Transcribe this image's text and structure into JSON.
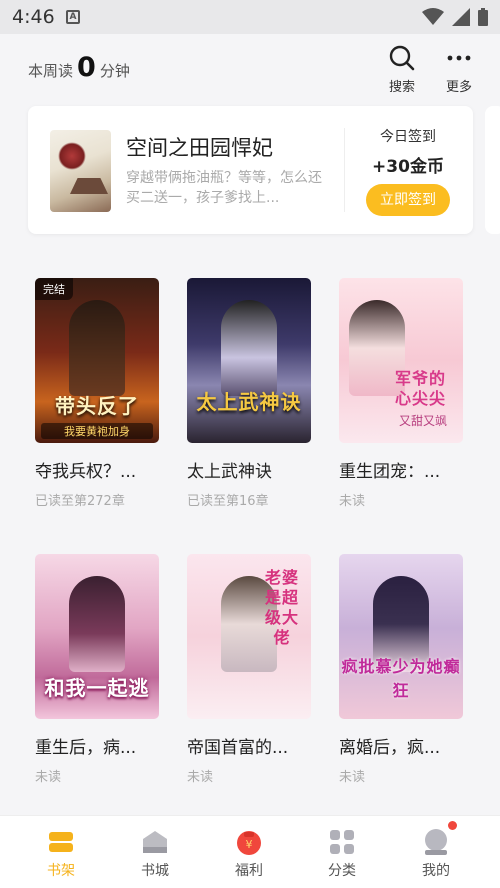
{
  "status_bar": {
    "time": "4:46",
    "notification_letter": "A"
  },
  "header": {
    "weekly_prefix": "本周读",
    "weekly_minutes": "0",
    "weekly_suffix": "分钟",
    "search_label": "搜索",
    "more_label": "更多"
  },
  "featured": {
    "title": "空间之田园悍妃",
    "description": "穿越带俩拖油瓶？等等，怎么还买二送一，孩子爹找上...",
    "checkin_label": "今日签到",
    "checkin_reward": "+30金币",
    "checkin_button": "立即签到"
  },
  "books": [
    {
      "title": "夺我兵权？...",
      "progress": "已读至第272章",
      "tag": "完结",
      "cover_text": "带头反了",
      "cover_subtitle": "我要黄袍加身"
    },
    {
      "title": "太上武神诀",
      "progress": "已读至第16章",
      "tag": "",
      "cover_text": "太上武神诀",
      "cover_subtitle": ""
    },
    {
      "title": "重生团宠：...",
      "progress": "未读",
      "tag": "",
      "cover_text": "军爷的心尖尖",
      "cover_subtitle": "又甜又飒"
    },
    {
      "title": "重生后，病...",
      "progress": "未读",
      "tag": "",
      "cover_text": "和我一起逃",
      "cover_subtitle": ""
    },
    {
      "title": "帝国首富的...",
      "progress": "未读",
      "tag": "",
      "cover_text": "老婆是超级大佬",
      "cover_subtitle": ""
    },
    {
      "title": "离婚后，疯...",
      "progress": "未读",
      "tag": "",
      "cover_text": "疯批慕少为她癫狂",
      "cover_subtitle": ""
    }
  ],
  "nav": {
    "items": [
      {
        "label": "书架",
        "icon": "bookshelf-icon"
      },
      {
        "label": "书城",
        "icon": "bookstore-icon"
      },
      {
        "label": "福利",
        "icon": "red-envelope-icon"
      },
      {
        "label": "分类",
        "icon": "category-grid-icon"
      },
      {
        "label": "我的",
        "icon": "profile-icon"
      }
    ]
  },
  "colors": {
    "accent": "#f5b21b",
    "checkin_button": "#fbbd20",
    "notification_dot": "#f0473c"
  }
}
